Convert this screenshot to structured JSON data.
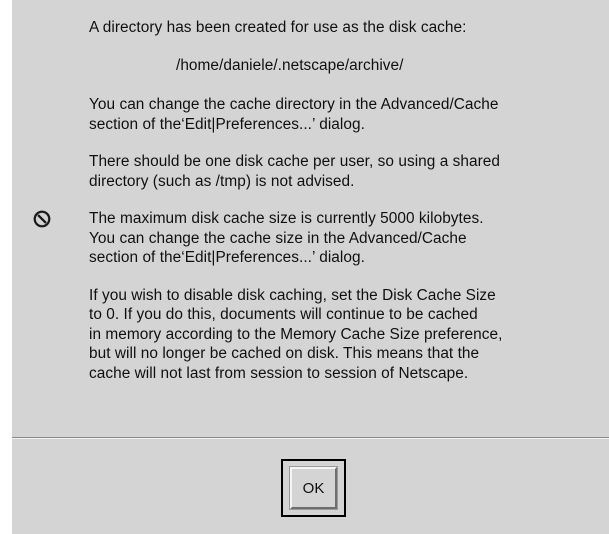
{
  "dialog": {
    "icon": "no-entry-icon",
    "paragraphs": [
      "A directory has been created for use as the disk cache:",
      "/home/daniele/.netscape/archive/",
      "You can change the cache directory in the Advanced/Cache\nsection of the‘Edit|Preferences...’ dialog.",
      "There should be one disk cache per user, so using a shared\ndirectory (such as /tmp) is not advised.",
      "The maximum disk cache size is currently 5000 kilobytes.\nYou can change the cache size in the Advanced/Cache\nsection of the‘Edit|Preferences...’ dialog.",
      "If you wish to disable disk caching, set the Disk Cache Size\nto 0.  If you do this, documents will continue to be cached\nin memory according to the Memory Cache Size preference,\nbut will no longer be cached on disk.  This means that the\ncache will not last from session to session of Netscape."
    ],
    "ok_label": "OK"
  }
}
